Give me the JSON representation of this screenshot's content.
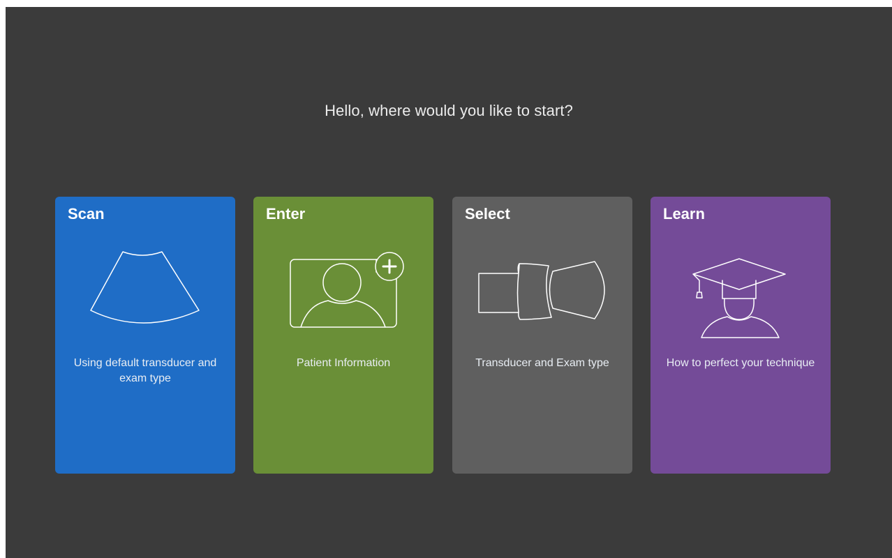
{
  "greeting": "Hello, where would you like to start?",
  "cards": [
    {
      "title": "Scan",
      "description": "Using default transducer and exam type",
      "icon": "ultrasound-sector-icon",
      "color": "#1f6dc6"
    },
    {
      "title": "Enter",
      "description": "Patient Information",
      "icon": "add-patient-icon",
      "color": "#6a8f37"
    },
    {
      "title": "Select",
      "description": "Transducer and Exam type",
      "icon": "transducer-icon",
      "color": "#5f5f5f"
    },
    {
      "title": "Learn",
      "description": "How to perfect your technique",
      "icon": "graduation-cap-icon",
      "color": "#744b98"
    }
  ]
}
